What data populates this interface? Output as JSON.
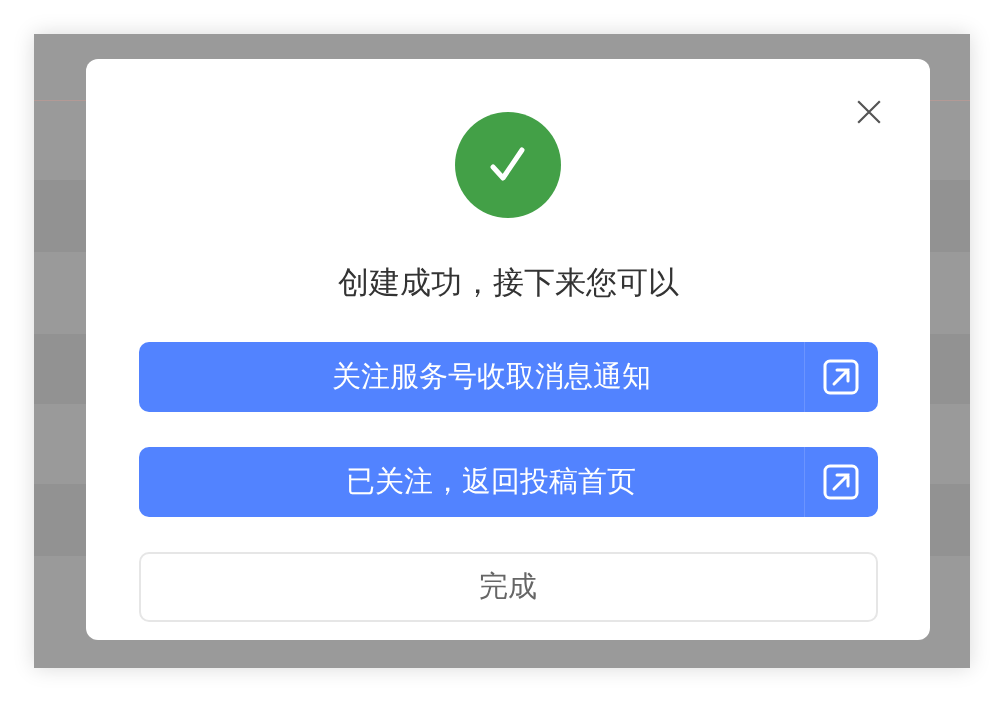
{
  "dialog": {
    "message": "创建成功，接下来您可以",
    "actions": [
      {
        "label": "关注服务号收取消息通知",
        "kind": "primary"
      },
      {
        "label": "已关注，返回投稿首页",
        "kind": "primary"
      },
      {
        "label": "完成",
        "kind": "secondary"
      }
    ]
  }
}
